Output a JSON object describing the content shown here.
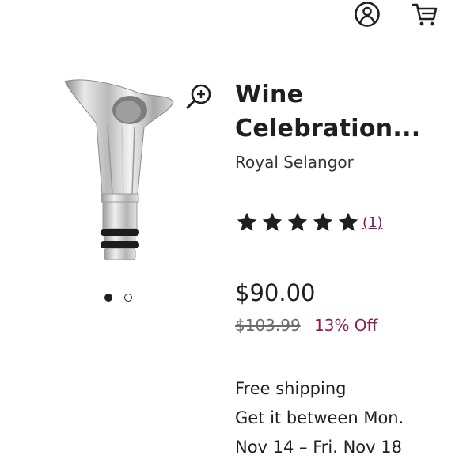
{
  "header": {
    "icons": [
      "account-icon",
      "cart-icon"
    ]
  },
  "product": {
    "title_line1": "Wine",
    "title_line2": "Celebration...",
    "brand": "Royal Selangor",
    "rating": 5,
    "review_count": "(1)",
    "price": "$90.00",
    "original_price": "$103.99",
    "discount": "13% Off",
    "shipping_line1": "Free shipping",
    "shipping_line2": "Get it between Mon.",
    "shipping_line3": "Nov 14 – Fri. Nov 18",
    "image_icon": "zoom-in-icon",
    "carousel": {
      "total": 2,
      "active": 1
    }
  },
  "colors": {
    "text": "#1f1f1f",
    "review_link": "#7b1a57",
    "discount": "#8e1e4f",
    "strike_price": "#6b6b6b"
  }
}
